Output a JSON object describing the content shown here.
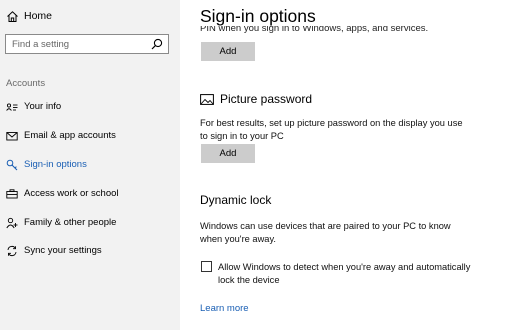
{
  "sidebar": {
    "home_label": "Home",
    "search_placeholder": "Find a setting",
    "section_heading": "Accounts",
    "items": [
      {
        "label": "Your info",
        "icon": "person-card-icon"
      },
      {
        "label": "Email & app accounts",
        "icon": "email-icon"
      },
      {
        "label": "Sign-in options",
        "icon": "key-icon",
        "active": true
      },
      {
        "label": "Access work or school",
        "icon": "briefcase-icon"
      },
      {
        "label": "Family & other people",
        "icon": "person-add-icon"
      },
      {
        "label": "Sync your settings",
        "icon": "sync-icon"
      }
    ]
  },
  "main": {
    "title": "Sign-in options",
    "pin_text_clipped": "PIN when you sign in to Windows, apps, and services.",
    "pin_add_label": "Add",
    "picture_password": {
      "heading": "Picture password",
      "description": "For best results, set up picture password on the display you use to sign in to your PC",
      "add_label": "Add"
    },
    "dynamic_lock": {
      "heading": "Dynamic lock",
      "description": "Windows can use devices that are paired to your PC to know when you're away.",
      "checkbox_label": "Allow Windows to detect when you're away and automatically lock the device",
      "checkbox_checked": false
    },
    "learn_more": "Learn more"
  },
  "colors": {
    "accent": "#1a5fb4",
    "sidebar_bg": "#f2f2f2",
    "button_bg": "#cccccc"
  }
}
